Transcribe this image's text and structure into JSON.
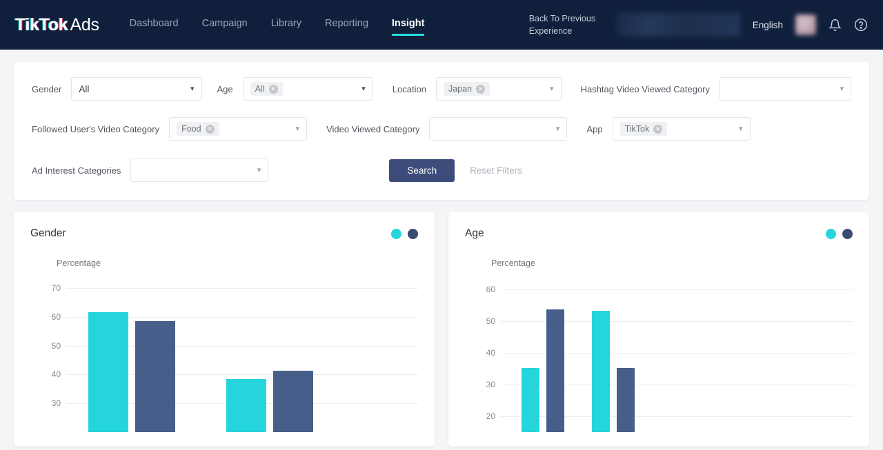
{
  "header": {
    "logo_tik": "TikTok",
    "logo_ads": "Ads",
    "nav": [
      {
        "label": "Dashboard",
        "active": false
      },
      {
        "label": "Campaign",
        "active": false
      },
      {
        "label": "Library",
        "active": false
      },
      {
        "label": "Reporting",
        "active": false
      },
      {
        "label": "Insight",
        "active": true
      }
    ],
    "back_experience": "Back To Previous Experience",
    "language": "English",
    "notification_icon": "bell-icon",
    "help_icon": "help-circle-icon"
  },
  "filters": {
    "gender": {
      "label": "Gender",
      "value": "All",
      "type": "select"
    },
    "age": {
      "label": "Age",
      "chips": [
        "All"
      ],
      "type": "multiselect"
    },
    "location": {
      "label": "Location",
      "chips": [
        "Japan"
      ],
      "type": "multiselect"
    },
    "hashtag_video_viewed_category": {
      "label": "Hashtag Video Viewed Category",
      "chips": [],
      "placeholder": "",
      "type": "multiselect"
    },
    "followed_users_video_category": {
      "label": "Followed User's Video Category",
      "chips": [
        "Food"
      ],
      "type": "multiselect"
    },
    "video_viewed_category": {
      "label": "Video Viewed Category",
      "chips": [],
      "placeholder": "",
      "type": "multiselect"
    },
    "app": {
      "label": "App",
      "chips": [
        "TikTok"
      ],
      "type": "multiselect"
    },
    "ad_interest_categories": {
      "label": "Ad Interest Categories",
      "chips": [],
      "placeholder": "",
      "type": "multiselect"
    },
    "search_label": "Search",
    "reset_label": "Reset Filters"
  },
  "colors": {
    "teal": "#26d4dc",
    "navy": "#475e8a",
    "legend_navy": "#3a4a72",
    "header_bg": "#10203c",
    "search_btn": "#3d4c7b",
    "accent_underline": "#25e0e3"
  },
  "chart_data": [
    {
      "type": "bar",
      "title": "Gender",
      "ylabel": "Percentage",
      "xlabel": "",
      "ylim": [
        20,
        75
      ],
      "ticks": [
        30,
        40,
        50,
        60,
        70
      ],
      "grid": true,
      "legend": [
        "teal-series",
        "navy-series"
      ],
      "legend_position": "top-right",
      "categories": [
        "group-1",
        "group-2"
      ],
      "series": [
        {
          "name": "teal-series",
          "color": "#26d4dc",
          "values": [
            61.5,
            38.5
          ]
        },
        {
          "name": "navy-series",
          "color": "#475e8a",
          "values": [
            58.5,
            41.3
          ]
        }
      ]
    },
    {
      "type": "bar",
      "title": "Age",
      "ylabel": "Percentage",
      "xlabel": "",
      "ylim": [
        15,
        65
      ],
      "ticks": [
        20,
        30,
        40,
        50,
        60
      ],
      "grid": true,
      "legend": [
        "teal-series",
        "navy-series"
      ],
      "legend_position": "top-right",
      "categories": [
        "group-1",
        "group-2"
      ],
      "series": [
        {
          "name": "teal-series",
          "color": "#26d4dc",
          "values": [
            35.2,
            53.2
          ]
        },
        {
          "name": "navy-series",
          "color": "#475e8a",
          "values": [
            53.8,
            35.2
          ]
        }
      ]
    }
  ]
}
